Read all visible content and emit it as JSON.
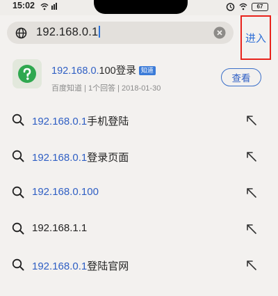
{
  "status": {
    "time": "15:02",
    "battery": "67"
  },
  "search": {
    "value": "192.168.0.1",
    "enter_label": "进入"
  },
  "top_result": {
    "title_hl": "192.168.0.",
    "title_rest": "100登录",
    "badge": "知道",
    "meta": "百度知道 | 1个回答 | 2018-01-30",
    "view_label": "查看"
  },
  "suggestions": [
    {
      "hl": "192.168.0.1",
      "rest": "手机登陆"
    },
    {
      "hl": "192.168.0.1",
      "rest": "登录页面"
    },
    {
      "hl": "192.168.0.100",
      "rest": ""
    },
    {
      "hl": "",
      "rest": "192.168.1.1"
    },
    {
      "hl": "192.168.0.1",
      "rest": "登陆官网"
    }
  ],
  "colors": {
    "accent": "#2f5fc4",
    "highlight_box": "#e8221b",
    "background": "#f3f1ef"
  }
}
